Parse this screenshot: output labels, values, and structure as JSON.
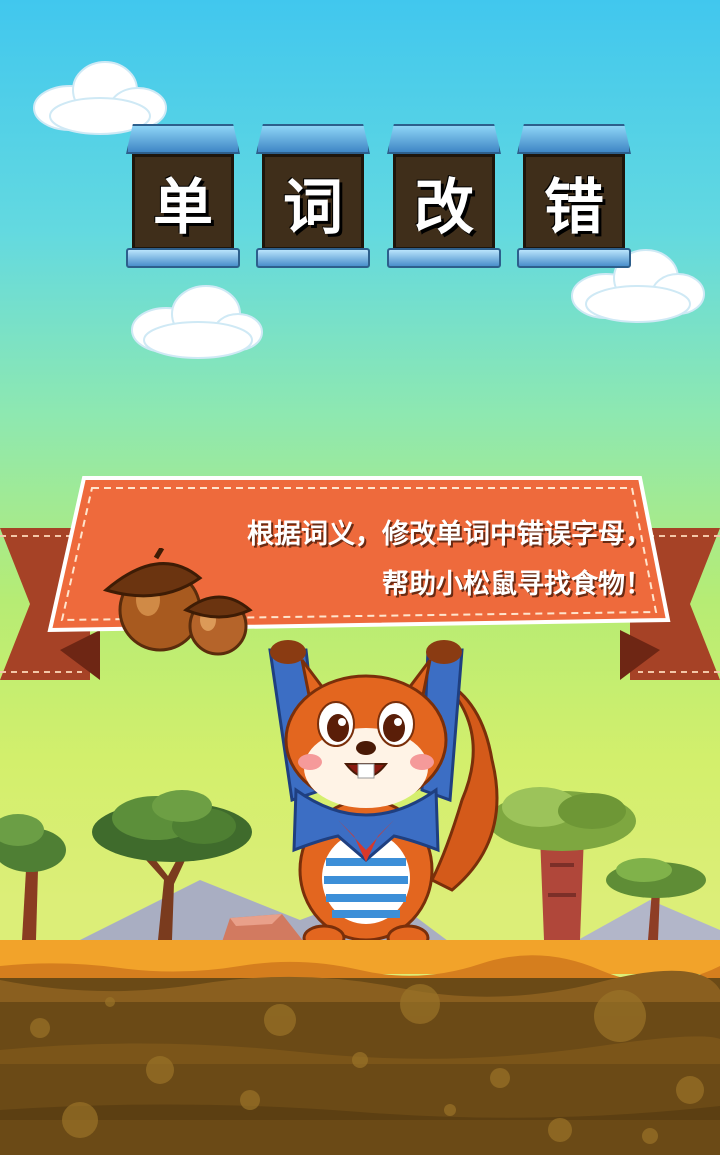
{
  "game": {
    "title_chars": [
      "单",
      "词",
      "改",
      "错"
    ],
    "instruction_line1": "根据词义，修改单词中错误字母，",
    "instruction_line2": "帮助小松鼠寻找食物！"
  },
  "colors": {
    "sky_top": "#41c7ee",
    "sky_bottom": "#dcee78",
    "banner": "#ee6a3c",
    "ribbon_ends": "#a64226",
    "tile": "#3f2e1a",
    "tile_cap": "#4a8fcb",
    "ground_top": "#f2a32a",
    "soil": "#6b4a16",
    "squirrel_fur": "#e3661f",
    "squirrel_jacket": "#3c6ec4"
  },
  "icons": [
    "cloud",
    "acorn",
    "squirrel",
    "acacia-tree",
    "mountain"
  ]
}
